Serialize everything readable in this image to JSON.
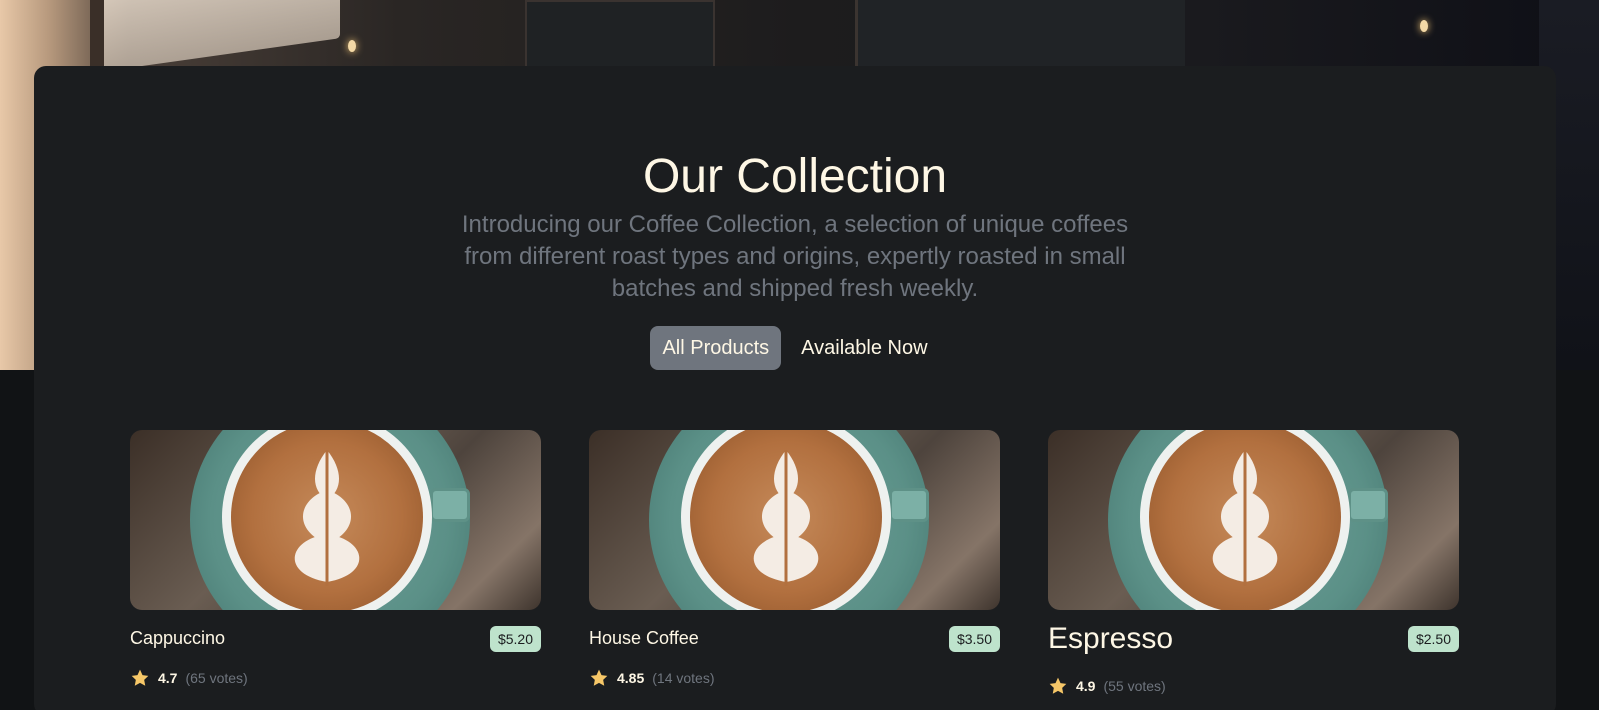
{
  "collection": {
    "title": "Our Collection",
    "subtitle": "Introducing our Coffee Collection, a selection of unique coffees from different roast types and origins, expertly roasted in small batches and shipped fresh weekly."
  },
  "filters": {
    "all_label": "All Products",
    "available_label": "Available Now",
    "active": "All Products"
  },
  "products": [
    {
      "name": "Cappuccino",
      "price": "$5.20",
      "rating": "4.7",
      "votes": "(65 votes)",
      "image_icon": "coffee-cup-image"
    },
    {
      "name": "House Coffee",
      "price": "$3.50",
      "rating": "4.85",
      "votes": "(14 votes)",
      "image_icon": "coffee-cup-image"
    },
    {
      "name": "Espresso",
      "price": "$2.50",
      "rating": "4.9",
      "votes": "(55 votes)",
      "image_icon": "coffee-cup-image"
    }
  ],
  "colors": {
    "panel_bg": "#1b1d1f",
    "title": "#fef7e5",
    "muted": "#6f757e",
    "price_bg": "#bee3cc",
    "star": "#f6c768"
  }
}
